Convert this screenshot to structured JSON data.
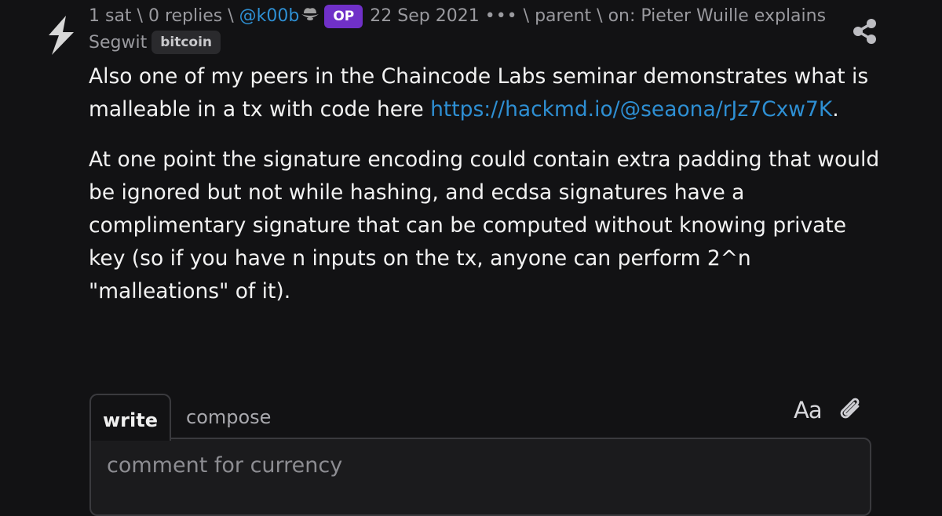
{
  "item": {
    "sats": "1 sat",
    "sep1": " \\ ",
    "replies": "0 replies",
    "sep2": " \\ ",
    "author": "@k00b",
    "op_badge": "OP",
    "date": "22 Sep 2021",
    "more": "•••",
    "sep3": " \\ ",
    "parent": "parent",
    "sep4": " \\ ",
    "on": "on: Pieter Wuille explains Segwit",
    "tag": "bitcoin"
  },
  "body": {
    "p1_text": "Also one of my peers in the Chaincode Labs seminar demonstrates what is malleable in a tx with code here ",
    "p1_link": "https://hackmd.io/@seaona/rJz7Cxw7K",
    "p1_end": ".",
    "p2": "At one point the signature encoding could contain extra padding that would be ignored but not while hashing, and ecdsa signatures have a complimentary signature that can be computed without knowing private key (so if you have n inputs on the tx, anyone can perform 2^n \"malleations\" of it)."
  },
  "reply": {
    "tab_write": "write",
    "tab_compose": "compose",
    "format_label": "Aa",
    "placeholder": "comment for currency"
  },
  "icons": {
    "upvote": "lightning-bolt-icon",
    "hat": "cowboy-hat-icon",
    "share": "share-icon",
    "attach": "paperclip-icon"
  },
  "colors": {
    "background": "#121214",
    "link": "#2e8fd3",
    "op_badge": "#7030c8",
    "tag_bg": "#2a2a2d"
  }
}
